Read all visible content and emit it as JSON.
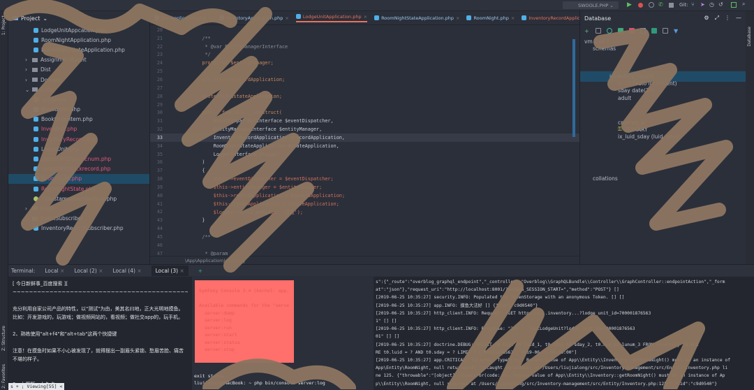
{
  "toolbar": {
    "run_config": "SWOOLE.PHP",
    "git_label": "Git:"
  },
  "left_strip": {
    "project": "1: Project",
    "structure": "Z: Structure",
    "favorites": "2: Favorites"
  },
  "right_strip": {
    "database": "Database"
  },
  "project": {
    "title": "Project",
    "items": [
      {
        "label": "LodgeUnitAppcation.php",
        "type": "file",
        "indent": 3
      },
      {
        "label": "RoomNightApplication.php",
        "type": "file",
        "indent": 3
      },
      {
        "label": "RoomNightStateApplication.php",
        "type": "file",
        "indent": 3
      },
      {
        "label": "AssignmentEvent",
        "type": "folder",
        "indent": 2
      },
      {
        "label": "Dist",
        "type": "folder",
        "indent": 2
      },
      {
        "label": "Domain",
        "type": "folder",
        "indent": 2
      },
      {
        "label": "Entity",
        "type": "folder-open",
        "indent": 2
      },
      {
        "label": ".gitignore",
        "type": "git",
        "indent": 3
      },
      {
        "label": "BookOrder.php",
        "type": "file",
        "indent": 3
      },
      {
        "label": "BookOrderItem.php",
        "type": "file",
        "indent": 3
      },
      {
        "label": "Inventory.php",
        "type": "file-red",
        "indent": 3
      },
      {
        "label": "InventoryRecord.php",
        "type": "file-red",
        "indent": 3
      },
      {
        "label": "LodgeUnit.php",
        "type": "file",
        "indent": 3
      },
      {
        "label": "LodgeUnitStatusEnum.php",
        "type": "file-red",
        "indent": 3
      },
      {
        "label": "LodgeUnitStockrecord.php",
        "type": "file-red",
        "indent": 3
      },
      {
        "label": "RoomNight.php",
        "type": "file-selected",
        "indent": 3
      },
      {
        "label": "RoomNightState.php",
        "type": "file-red",
        "indent": 3
      },
      {
        "label": "TimestampableInterface.php",
        "type": "interface",
        "indent": 3
      },
      {
        "label": "Event",
        "type": "folder",
        "indent": 2
      },
      {
        "label": "EventSubscriber",
        "type": "folder-open",
        "indent": 2
      },
      {
        "label": "InventoryRecordSubscriber.php",
        "type": "file",
        "indent": 3
      }
    ]
  },
  "editor": {
    "tabs": [
      {
        "label": "JsonApplication.php",
        "active": false
      },
      {
        "label": "InventoryApplication.php",
        "active": false
      },
      {
        "label": "LodgeUnitApplication.php",
        "active": true
      },
      {
        "label": "RoomNightStateApplication.php",
        "active": false
      },
      {
        "label": "RoomNight.php",
        "active": false
      },
      {
        "label": "InventoryRecordApplication.php",
        "active": false
      }
    ],
    "lines": [
      {
        "n": "20",
        "t": ""
      },
      {
        "n": "21",
        "t": "    /**"
      },
      {
        "n": "22",
        "t": "     * @var EntityManagerInterface"
      },
      {
        "n": "23",
        "t": "     */"
      },
      {
        "n": "24",
        "t": "    protected $entityManager;"
      },
      {
        "n": "25",
        "t": ""
      },
      {
        "n": "26",
        "t": "    protected $recordApplication;"
      },
      {
        "n": "27",
        "t": ""
      },
      {
        "n": "28",
        "t": "    protected $stateApplication;"
      },
      {
        "n": "29",
        "t": ""
      },
      {
        "n": "30",
        "t": "    public function __construct("
      },
      {
        "n": "31",
        "t": "        EventDispatcherInterface $eventDispatcher,"
      },
      {
        "n": "32",
        "t": "        EntityManagerInterface $entityManager,"
      },
      {
        "n": "33",
        "t": "        InventoryRecordApplication $recordApplication,"
      },
      {
        "n": "34",
        "t": "        RoomNightStateApplication $stateApplication,"
      },
      {
        "n": "35",
        "t": "        LoggerInterface $logger"
      },
      {
        "n": "36",
        "t": "    )"
      },
      {
        "n": "37",
        "t": "    {"
      },
      {
        "n": "38",
        "t": "        $this->eventDispatcher = $eventDispatcher;"
      },
      {
        "n": "39",
        "t": "        $this->entityManager = $entityManager;"
      },
      {
        "n": "40",
        "t": "        $this->recordApplication = $recordApplication;"
      },
      {
        "n": "41",
        "t": "        $this->stateApplication = $stateApplication;"
      },
      {
        "n": "42",
        "t": "        $logger->info( message: '摸鱼');"
      },
      {
        "n": "43",
        "t": "    }"
      },
      {
        "n": "44",
        "t": ""
      },
      {
        "n": "45",
        "t": "    /**"
      },
      {
        "n": "46",
        "t": ""
      },
      {
        "n": "47",
        "t": "     * @param"
      }
    ],
    "current_line": "33",
    "breadcrumb": "\\App\\Application\\Inventory"
  },
  "database": {
    "title": "Database",
    "items": [
      {
        "label": "vm  1 of 7",
        "indent": 0
      },
      {
        "label": "schemas",
        "indent": 1
      },
      {
        "label": "inventory_record",
        "indent": 3,
        "selected": true
      },
      {
        "label": "id int (auto increment)",
        "indent": 4
      },
      {
        "label": "sday date(30)",
        "indent": 4
      },
      {
        "label": "adult",
        "indent": 4
      },
      {
        "label": "created_at",
        "indent": 4
      },
      {
        "label": "PRIMARY",
        "indent": 4
      },
      {
        "label": "ix_luid_sday (luid, sday)",
        "indent": 4
      },
      {
        "label": "collations",
        "indent": 1
      }
    ]
  },
  "terminal": {
    "label": "Terminal:",
    "tabs": [
      {
        "label": "Local",
        "active": false
      },
      {
        "label": "Local (2)",
        "active": false
      },
      {
        "label": "Local (4)",
        "active": false
      },
      {
        "label": "Local (3)",
        "active": true
      }
    ],
    "add": "+",
    "left_lines": [
      "[       今日新鲜事_百度搜索        ][",
      "~~~~~~~~~~~~~~~~~~~~~~~~~~~~~~~~~~~~~~~~~~~~~~~~~~~~",
      "",
      "    充分利用自家公司产品的特性，以\"测试\"为由，美其名曰地，正大光明地摸鱼。比如：开发游戏的，玩游戏；做视频网站的，看视频；做社交app的，玩手机。",
      "",
      "2、熟练使用\"alt+f4\"和\"alt+tab\"这两个快捷键",
      "",
      "    注意！在摸鱼时如果不小心被发现了，就得摆出一副眉头紧锁、愁眉苦脸、痛苦不堪的样子。",
      "",
      "",
      "3、上厕所，上久点"
    ],
    "left_status": "s + ; Viewing[55] <",
    "mid_box_lines": [
      "Symfony Console 3.4 (kernel: app, env: dev)",
      "",
      "Available commands for the \"server\" namespace:",
      "  server:dump",
      "  server:log",
      "  server:run",
      "  server:start",
      "  server:status",
      "  server:stop"
    ],
    "mid_lines": [
      "exit status",
      "liujialong@MacBook: ~ php bin/console server:log"
    ],
    "log_lines": [
      "s\":{\"_route\":\"overblog_graphql_endpoint\",\"_controller\":\"Overblog\\\\GraphQLBundle\\\\Controller\\\\GraphController::endpointAction\",\"_form",
      "at\":\"json\"},\"request_uri\":\"http://localhost:8001/?XDEBUG_SESSION_START=\",\"method\":\"POST\"} []",
      "[2019-06-25 10:35:27] security.INFO: Populated the TokenStorage with an anonymous Token. [] []",
      "[2019-06-25 10:35:27] app.INFO: 摸鱼大法好 [] {\"uid\":\"c9d0540\"}",
      "[2019-06-25 10:35:27] http_client.INFO: Request: \"GET http://s...inventory...?lodge_unit_id=700001876563",
      "1\" [] []",
      "[2019-06-25 10:35:27] http_client.INFO: Response: \"200 .../GetLodgeUnit?lodge_unit_id=700001876563",
      "01\" [] []",
      "[2019-06-25 10:35:27] doctrine.DEBUG: SELECT t0.luid AS luid_1, t0.sday AS sday_2, t0.num AS lunum_3 FROM inventory t0 WHE",
      "RE t0.luid = ? AND t0.sday = ? LIMIT 1 [7000018765631,\"2019-06-25 00:00:00\"]",
      "[2019-06-25 10:35:27] app.CRITICAL: [GraphQL] TypeError: Return value of App\\\\Entity\\\\Inventory::getRoomNight() must be an instance of",
      " App\\Entity\\RoomNight, null returned[0] (uncaught throwable) at /Users/liujialong/src/Inventory-management/src/Entity/Inventory.php li",
      "ne 125. {\"throwable\":\"[object] (TypeError(code: 0): Return value of App\\\\Entity\\\\Inventory::getRoomNight() must be an instance of Ap",
      "p\\\\Entity\\\\RoomNight, null returned at /Users/liujialong/src/Inventory-management/src/Entity/Inventory.php:125)\",\"uid\":\"c9d0540\"}"
    ]
  },
  "colors": {
    "accent": "#e8735d",
    "selection": "#1f4b67",
    "scribble": "#8b7560",
    "red_box": "#ff6f6b"
  }
}
